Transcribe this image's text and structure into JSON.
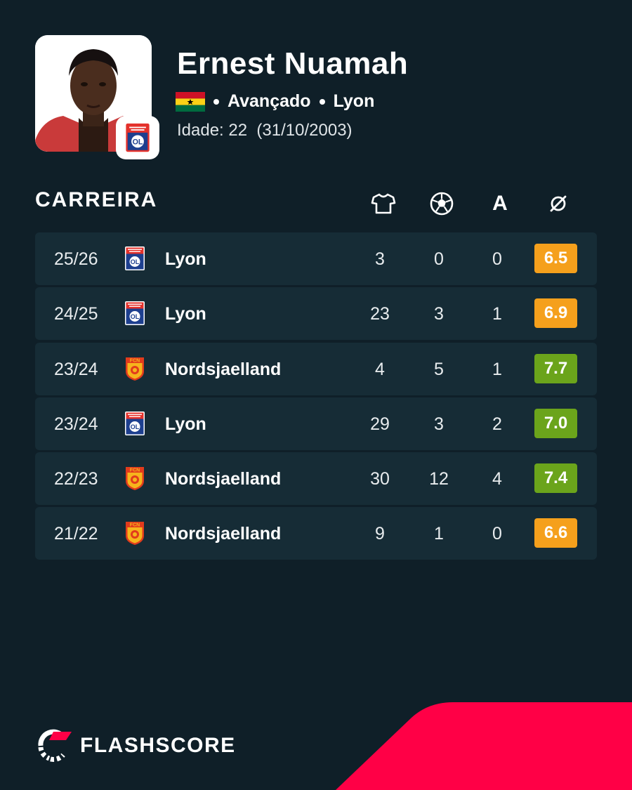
{
  "player": {
    "name": "Ernest Nuamah",
    "position": "Avançado",
    "club": "Lyon",
    "age_text": "Idade: 22  (31/10/2003)"
  },
  "table": {
    "title": "CARREIRA",
    "columns": [
      {
        "icon": "shirt-icon"
      },
      {
        "icon": "ball-icon"
      },
      {
        "label": "A"
      },
      {
        "icon": "average-icon"
      }
    ],
    "rows": [
      {
        "season": "25/26",
        "team": "Lyon",
        "badge": "lyon",
        "apps": "3",
        "goals": "0",
        "assists": "0",
        "rating": "6.5",
        "rating_color": "#f5a01c"
      },
      {
        "season": "24/25",
        "team": "Lyon",
        "badge": "lyon",
        "apps": "23",
        "goals": "3",
        "assists": "1",
        "rating": "6.9",
        "rating_color": "#f5a01c"
      },
      {
        "season": "23/24",
        "team": "Nordsjaelland",
        "badge": "fcn",
        "apps": "4",
        "goals": "5",
        "assists": "1",
        "rating": "7.7",
        "rating_color": "#6ba41b"
      },
      {
        "season": "23/24",
        "team": "Lyon",
        "badge": "lyon",
        "apps": "29",
        "goals": "3",
        "assists": "2",
        "rating": "7.0",
        "rating_color": "#6ba41b"
      },
      {
        "season": "22/23",
        "team": "Nordsjaelland",
        "badge": "fcn",
        "apps": "30",
        "goals": "12",
        "assists": "4",
        "rating": "7.4",
        "rating_color": "#6ba41b"
      },
      {
        "season": "21/22",
        "team": "Nordsjaelland",
        "badge": "fcn",
        "apps": "9",
        "goals": "1",
        "assists": "0",
        "rating": "6.6",
        "rating_color": "#f5a01c"
      }
    ]
  },
  "brand": {
    "name": "FLASHSCORE",
    "accent": "#ff0046",
    "background": "#0f1f28",
    "row_background": "#162c36"
  }
}
